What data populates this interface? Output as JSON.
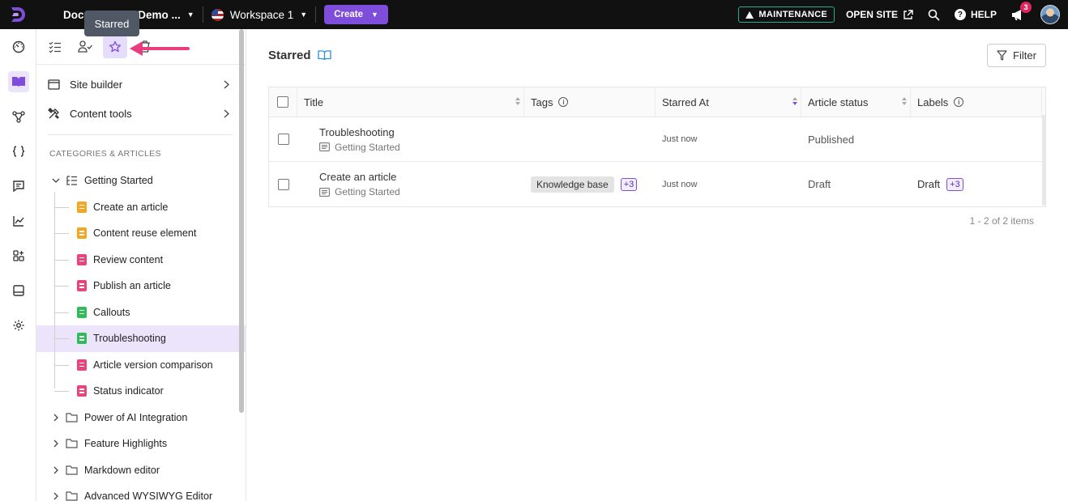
{
  "topbar": {
    "project_name": "Document360 Demo ...",
    "workspace": "Workspace 1",
    "create_label": "Create",
    "maintenance_label": "MAINTENANCE",
    "open_site_label": "OPEN SITE",
    "help_label": "HELP",
    "notification_count": "3"
  },
  "tooltip": {
    "text": "Starred"
  },
  "sidebar": {
    "links": [
      {
        "label": "Site builder"
      },
      {
        "label": "Content tools"
      }
    ],
    "section_title": "CATEGORIES & ARTICLES",
    "root_category": "Getting Started",
    "articles": [
      {
        "label": "Create an article",
        "color": "#f5a623"
      },
      {
        "label": "Content reuse element",
        "color": "#f5a623"
      },
      {
        "label": "Review content",
        "color": "#e8457a"
      },
      {
        "label": "Publish an article",
        "color": "#e8457a"
      },
      {
        "label": "Callouts",
        "color": "#2ebd59"
      },
      {
        "label": "Troubleshooting",
        "color": "#2ebd59"
      },
      {
        "label": "Article version comparison",
        "color": "#e8457a"
      },
      {
        "label": "Status indicator",
        "color": "#e8457a"
      }
    ],
    "categories": [
      {
        "label": "Power of AI Integration"
      },
      {
        "label": "Feature Highlights"
      },
      {
        "label": "Markdown editor"
      },
      {
        "label": "Advanced WYSIWYG Editor"
      }
    ]
  },
  "main": {
    "title": "Starred",
    "filter_label": "Filter",
    "columns": {
      "title": "Title",
      "tags": "Tags",
      "starred_at": "Starred At",
      "status": "Article status",
      "labels": "Labels"
    },
    "rows": [
      {
        "title": "Troubleshooting",
        "category": "Getting Started",
        "tag": "",
        "tag_more": "",
        "starred_at": "Just now",
        "status": "Published",
        "label": "",
        "label_more": ""
      },
      {
        "title": "Create an article",
        "category": "Getting Started",
        "tag": "Knowledge base",
        "tag_more": "+3",
        "starred_at": "Just now",
        "status": "Draft",
        "label": "Draft",
        "label_more": "+3"
      }
    ],
    "pagination": "1 - 2 of 2 items"
  },
  "colors": {
    "accent": "#7f4ddb",
    "topbar": "#111111",
    "selected": "#ece4fb"
  }
}
